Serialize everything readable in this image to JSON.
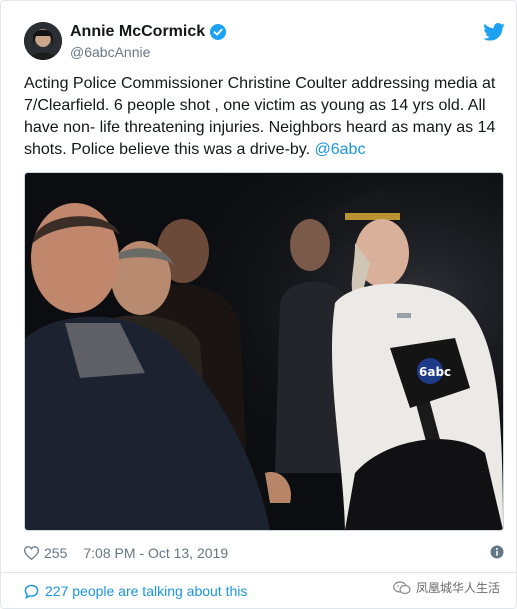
{
  "author": {
    "display_name": "Annie McCormick",
    "handle": "@6abcAnnie"
  },
  "tweet": {
    "text": "Acting Police Commissioner Christine Coulter addressing media at 7/Clearfield. 6 people shot , one victim as young as 14 yrs old. All have non- life threatening injuries. Neighbors heard as many as 14 shots. Police believe this was a drive-by. ",
    "mention": "@6abc"
  },
  "stats": {
    "likes": "255",
    "timestamp": "7:08 PM - Oct 13, 2019"
  },
  "footer": {
    "talking": "227 people are talking about this"
  },
  "watermark": {
    "text": "凤凰城华人生活"
  },
  "colors": {
    "link": "#1b95e0",
    "verified": "#1da1f2",
    "secondary_text": "#657786",
    "border": "#e1e8ed"
  },
  "icons": [
    "verified-badge-icon",
    "twitter-bird-icon",
    "heart-icon",
    "info-icon",
    "speech-bubble-icon",
    "wechat-icon"
  ]
}
